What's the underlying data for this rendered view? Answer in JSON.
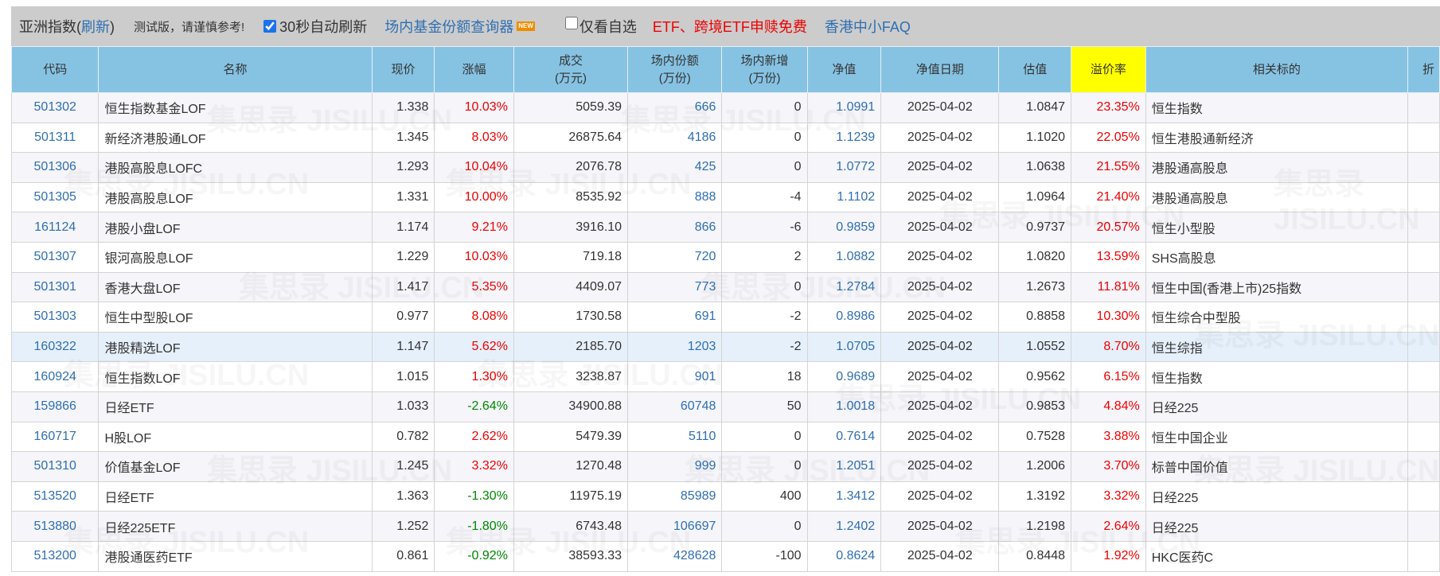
{
  "topbar": {
    "title_prefix": "亚洲指数(",
    "refresh_link": "刷新",
    "title_suffix": ")",
    "note": "测试版，请谨慎参考!",
    "auto_refresh_label": "30秒自动刷新",
    "auto_refresh_checked": true,
    "fund_query_link": "场内基金份额查询器",
    "new_badge": "NEW",
    "only_watchlist_label": "仅看自选",
    "only_watchlist_checked": false,
    "promo_link": "ETF、跨境ETF申赎免费",
    "faq_link": "香港中小FAQ"
  },
  "table": {
    "headers": [
      "代码",
      "名称",
      "现价",
      "涨幅",
      "成交\n(万元)",
      "场内份额\n(万份)",
      "场内新增\n(万份)",
      "净值",
      "净值日期",
      "估值",
      "溢价率",
      "相关标的",
      "折"
    ],
    "highlight_header": "溢价率",
    "rows": [
      {
        "code": "501302",
        "name": "恒生指数基金LOF",
        "price": "1.338",
        "change": "10.03%",
        "volume": "5059.39",
        "shares": "666",
        "new_shares": "0",
        "nav": "1.0991",
        "nav_date": "2025-04-02",
        "estimate": "1.0847",
        "premium": "23.35%",
        "related": "恒生指数"
      },
      {
        "code": "501311",
        "name": "新经济港股通LOF",
        "price": "1.345",
        "change": "8.03%",
        "volume": "26875.64",
        "shares": "4186",
        "new_shares": "0",
        "nav": "1.1239",
        "nav_date": "2025-04-02",
        "estimate": "1.1020",
        "premium": "22.05%",
        "related": "恒生港股通新经济"
      },
      {
        "code": "501306",
        "name": "港股高股息LOFC",
        "price": "1.293",
        "change": "10.04%",
        "volume": "2076.78",
        "shares": "425",
        "new_shares": "0",
        "nav": "1.0772",
        "nav_date": "2025-04-02",
        "estimate": "1.0638",
        "premium": "21.55%",
        "related": "港股通高股息"
      },
      {
        "code": "501305",
        "name": "港股高股息LOF",
        "price": "1.331",
        "change": "10.00%",
        "volume": "8535.92",
        "shares": "888",
        "new_shares": "-4",
        "nav": "1.1102",
        "nav_date": "2025-04-02",
        "estimate": "1.0964",
        "premium": "21.40%",
        "related": "港股通高股息"
      },
      {
        "code": "161124",
        "name": "港股小盘LOF",
        "price": "1.174",
        "change": "9.21%",
        "volume": "3916.10",
        "shares": "866",
        "new_shares": "-6",
        "nav": "0.9859",
        "nav_date": "2025-04-02",
        "estimate": "0.9737",
        "premium": "20.57%",
        "related": "恒生小型股"
      },
      {
        "code": "501307",
        "name": "银河高股息LOF",
        "price": "1.229",
        "change": "10.03%",
        "volume": "719.18",
        "shares": "720",
        "new_shares": "2",
        "nav": "1.0882",
        "nav_date": "2025-04-02",
        "estimate": "1.0820",
        "premium": "13.59%",
        "related": "SHS高股息"
      },
      {
        "code": "501301",
        "name": "香港大盘LOF",
        "price": "1.417",
        "change": "5.35%",
        "volume": "4409.07",
        "shares": "773",
        "new_shares": "0",
        "nav": "1.2784",
        "nav_date": "2025-04-02",
        "estimate": "1.2673",
        "premium": "11.81%",
        "related": "恒生中国(香港上市)25指数"
      },
      {
        "code": "501303",
        "name": "恒生中型股LOF",
        "price": "0.977",
        "change": "8.08%",
        "volume": "1730.58",
        "shares": "691",
        "new_shares": "-2",
        "nav": "0.8986",
        "nav_date": "2025-04-02",
        "estimate": "0.8858",
        "premium": "10.30%",
        "related": "恒生综合中型股"
      },
      {
        "code": "160322",
        "name": "港股精选LOF",
        "price": "1.147",
        "change": "5.62%",
        "volume": "2185.70",
        "shares": "1203",
        "new_shares": "-2",
        "nav": "1.0705",
        "nav_date": "2025-04-02",
        "estimate": "1.0552",
        "premium": "8.70%",
        "related": "恒生综指",
        "selected": true
      },
      {
        "code": "160924",
        "name": "恒生指数LOF",
        "price": "1.015",
        "change": "1.30%",
        "volume": "3238.87",
        "shares": "901",
        "new_shares": "18",
        "nav": "0.9689",
        "nav_date": "2025-04-02",
        "estimate": "0.9562",
        "premium": "6.15%",
        "related": "恒生指数"
      },
      {
        "code": "159866",
        "name": "日经ETF",
        "price": "1.033",
        "change": "-2.64%",
        "volume": "34900.88",
        "shares": "60748",
        "new_shares": "50",
        "nav": "1.0018",
        "nav_date": "2025-04-02",
        "estimate": "0.9853",
        "premium": "4.84%",
        "related": "日经225"
      },
      {
        "code": "160717",
        "name": "H股LOF",
        "price": "0.782",
        "change": "2.62%",
        "volume": "5479.39",
        "shares": "5110",
        "new_shares": "0",
        "nav": "0.7614",
        "nav_date": "2025-04-02",
        "estimate": "0.7528",
        "premium": "3.88%",
        "related": "恒生中国企业"
      },
      {
        "code": "501310",
        "name": "价值基金LOF",
        "price": "1.245",
        "change": "3.32%",
        "volume": "1270.48",
        "shares": "999",
        "new_shares": "0",
        "nav": "1.2051",
        "nav_date": "2025-04-02",
        "estimate": "1.2006",
        "premium": "3.70%",
        "related": "标普中国价值"
      },
      {
        "code": "513520",
        "name": "日经ETF",
        "price": "1.363",
        "change": "-1.30%",
        "volume": "11975.19",
        "shares": "85989",
        "new_shares": "400",
        "nav": "1.3412",
        "nav_date": "2025-04-02",
        "estimate": "1.3192",
        "premium": "3.32%",
        "related": "日经225"
      },
      {
        "code": "513880",
        "name": "日经225ETF",
        "price": "1.252",
        "change": "-1.80%",
        "volume": "6743.48",
        "shares": "106697",
        "new_shares": "0",
        "nav": "1.2402",
        "nav_date": "2025-04-02",
        "estimate": "1.2198",
        "premium": "2.64%",
        "related": "日经225"
      },
      {
        "code": "513200",
        "name": "港股通医药ETF",
        "price": "0.861",
        "change": "-0.92%",
        "volume": "38593.33",
        "shares": "428628",
        "new_shares": "-100",
        "nav": "0.8624",
        "nav_date": "2025-04-02",
        "estimate": "0.8448",
        "premium": "1.92%",
        "related": "HKC医药C"
      }
    ]
  },
  "watermark": "集思录 JISILU.CN",
  "colors": {
    "header_bg": "#86c3e3",
    "highlight": "#ffff00",
    "up": "#ee0000",
    "down": "#008800",
    "link": "#2f6fb0",
    "topbar_bg": "#cccccc"
  }
}
